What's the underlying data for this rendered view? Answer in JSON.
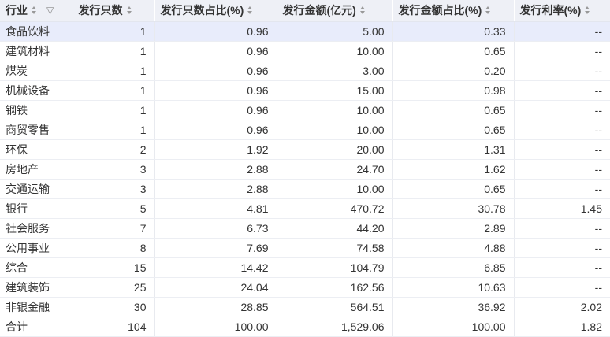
{
  "headers": [
    "行业",
    "发行只数",
    "发行只数占比(%)",
    "发行金额(亿元)",
    "发行金额占比(%)",
    "发行利率(%)"
  ],
  "rows": [
    [
      "食品饮料",
      "1",
      "0.96",
      "5.00",
      "0.33",
      "--"
    ],
    [
      "建筑材料",
      "1",
      "0.96",
      "10.00",
      "0.65",
      "--"
    ],
    [
      "煤炭",
      "1",
      "0.96",
      "3.00",
      "0.20",
      "--"
    ],
    [
      "机械设备",
      "1",
      "0.96",
      "15.00",
      "0.98",
      "--"
    ],
    [
      "钢铁",
      "1",
      "0.96",
      "10.00",
      "0.65",
      "--"
    ],
    [
      "商贸零售",
      "1",
      "0.96",
      "10.00",
      "0.65",
      "--"
    ],
    [
      "环保",
      "2",
      "1.92",
      "20.00",
      "1.31",
      "--"
    ],
    [
      "房地产",
      "3",
      "2.88",
      "24.70",
      "1.62",
      "--"
    ],
    [
      "交通运输",
      "3",
      "2.88",
      "10.00",
      "0.65",
      "--"
    ],
    [
      "银行",
      "5",
      "4.81",
      "470.72",
      "30.78",
      "1.45"
    ],
    [
      "社会服务",
      "7",
      "6.73",
      "44.20",
      "2.89",
      "--"
    ],
    [
      "公用事业",
      "8",
      "7.69",
      "74.58",
      "4.88",
      "--"
    ],
    [
      "综合",
      "15",
      "14.42",
      "104.79",
      "6.85",
      "--"
    ],
    [
      "建筑装饰",
      "25",
      "24.04",
      "162.56",
      "10.63",
      "--"
    ],
    [
      "非银金融",
      "30",
      "28.85",
      "564.51",
      "36.92",
      "2.02"
    ],
    [
      "合计",
      "104",
      "100.00",
      "1,529.06",
      "100.00",
      "1.82"
    ]
  ],
  "highlighted_row": 0,
  "icons": {
    "sort": "sort-arrows-icon",
    "filter": "filter-icon"
  },
  "colors": {
    "header_bg": "#eef0f6",
    "highlight_bg": "#e8ecfb",
    "border": "#e8eaef"
  }
}
